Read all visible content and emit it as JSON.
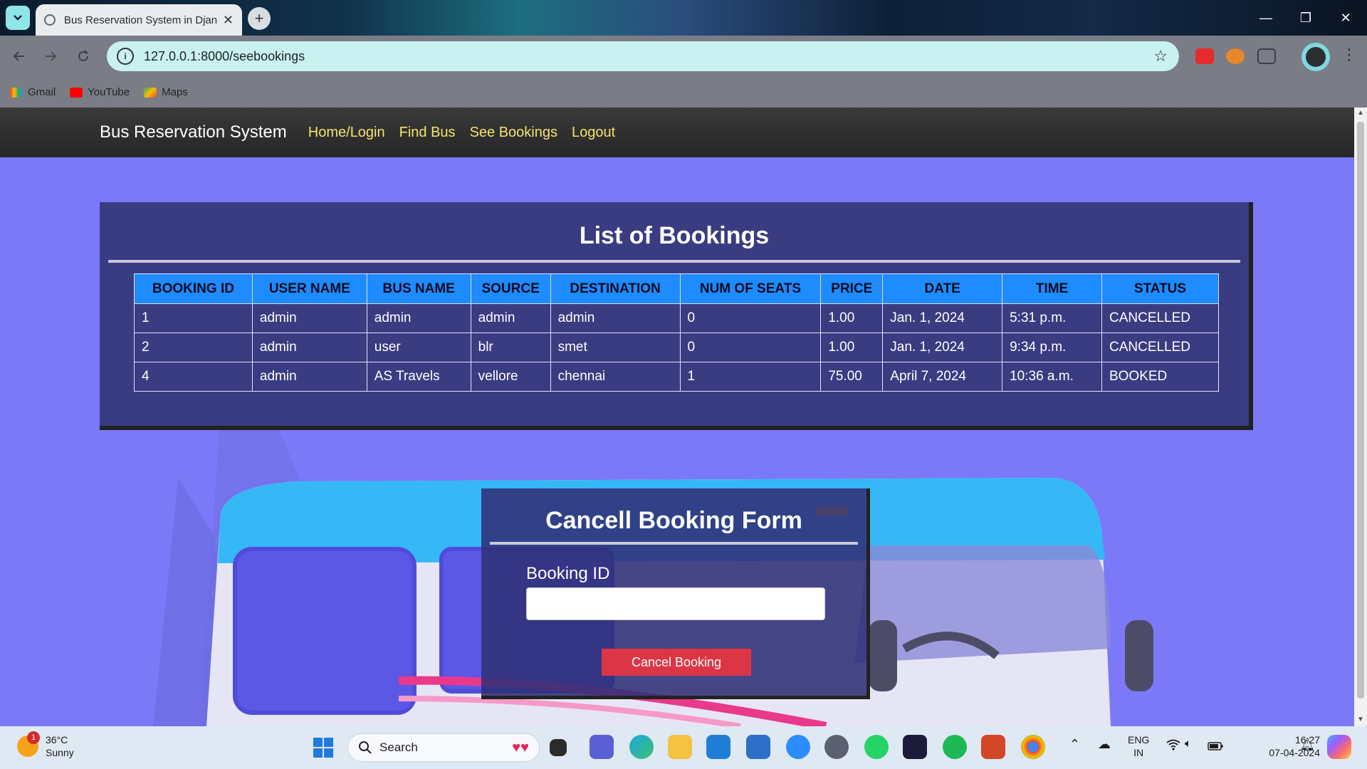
{
  "browser": {
    "tab_title": "Bus Reservation System in Djan",
    "tab_close": "✕",
    "new_tab": "+",
    "url": "127.0.0.1:8000/seebookings",
    "bookmarks": [
      "Gmail",
      "YouTube",
      "Maps"
    ],
    "window_controls": [
      "—",
      "❐",
      "✕"
    ]
  },
  "navbar": {
    "brand": "Bus Reservation System",
    "links": [
      "Home/Login",
      "Find Bus",
      "See Bookings",
      "Logout"
    ]
  },
  "bookings": {
    "title": "List of Bookings",
    "columns": [
      "BOOKING ID",
      "USER NAME",
      "BUS NAME",
      "SOURCE",
      "DESTINATION",
      "NUM OF SEATS",
      "PRICE",
      "DATE",
      "TIME",
      "STATUS"
    ],
    "rows": [
      [
        "1",
        "admin",
        "admin",
        "admin",
        "admin",
        "0",
        "1.00",
        "Jan. 1, 2024",
        "5:31 p.m.",
        "CANCELLED"
      ],
      [
        "2",
        "admin",
        "user",
        "blr",
        "smet",
        "0",
        "1.00",
        "Jan. 1, 2024",
        "9:34 p.m.",
        "CANCELLED"
      ],
      [
        "4",
        "admin",
        "AS Travels",
        "vellore",
        "chennai",
        "1",
        "75.00",
        "April 7, 2024",
        "10:36 a.m.",
        "BOOKED"
      ]
    ]
  },
  "cancel_form": {
    "title": "Cancell Booking Form",
    "field_label": "Booking ID",
    "field_value": "",
    "submit_label": "Cancel Booking"
  },
  "taskbar": {
    "weather_temp": "36°C",
    "weather_desc": "Sunny",
    "weather_badge": "1",
    "search_label": "Search",
    "lang_top": "ENG",
    "lang_bottom": "IN",
    "time": "16:27",
    "date": "07-04-2024"
  },
  "colors": {
    "page_bg": "#7b79f8",
    "card_bg": "#3a3c82",
    "table_header": "#1e8bff",
    "nav_link": "#f3e36c",
    "danger": "#dc3545"
  }
}
